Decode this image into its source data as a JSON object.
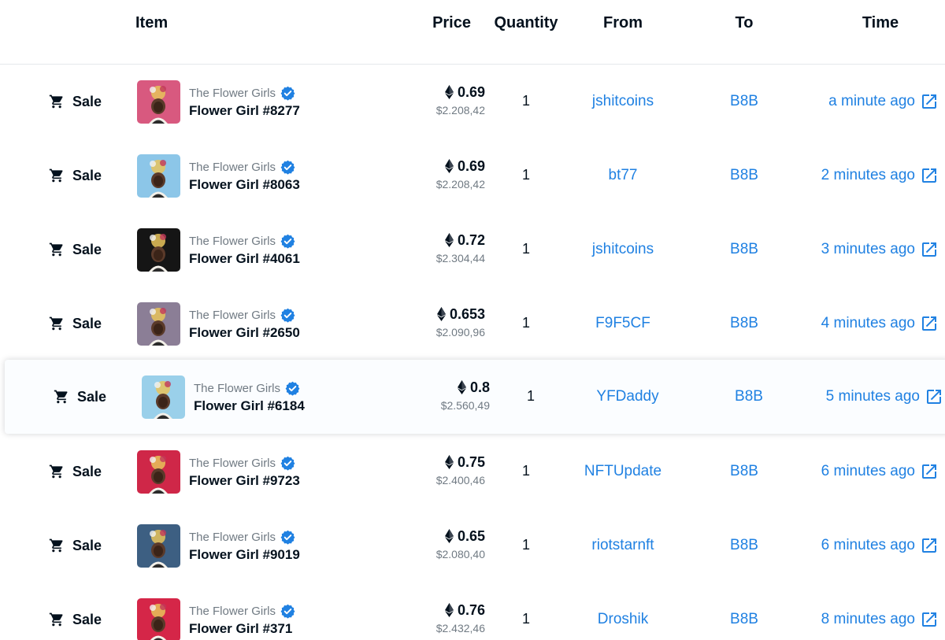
{
  "header": {
    "item": "Item",
    "price": "Price",
    "quantity": "Quantity",
    "from": "From",
    "to": "To",
    "time": "Time"
  },
  "rows": [
    {
      "event": "Sale",
      "collection": "The Flower Girls",
      "name": "Flower Girl #8277",
      "price_eth": "0.69",
      "price_usd": "$2.208,42",
      "quantity": "1",
      "from": "jshitcoins",
      "to": "B8B",
      "time": "a minute ago",
      "thumb_bg": "#d8597f"
    },
    {
      "event": "Sale",
      "collection": "The Flower Girls",
      "name": "Flower Girl #8063",
      "price_eth": "0.69",
      "price_usd": "$2.208,42",
      "quantity": "1",
      "from": "bt77",
      "to": "B8B",
      "time": "2 minutes ago",
      "thumb_bg": "#8cc6e8"
    },
    {
      "event": "Sale",
      "collection": "The Flower Girls",
      "name": "Flower Girl #4061",
      "price_eth": "0.72",
      "price_usd": "$2.304,44",
      "quantity": "1",
      "from": "jshitcoins",
      "to": "B8B",
      "time": "3 minutes ago",
      "thumb_bg": "#151515"
    },
    {
      "event": "Sale",
      "collection": "The Flower Girls",
      "name": "Flower Girl #2650",
      "price_eth": "0.653",
      "price_usd": "$2.090,96",
      "quantity": "1",
      "from": "F9F5CF",
      "to": "B8B",
      "time": "4 minutes ago",
      "thumb_bg": "#8b7e96"
    },
    {
      "event": "Sale",
      "collection": "The Flower Girls",
      "name": "Flower Girl #6184",
      "price_eth": "0.8",
      "price_usd": "$2.560,49",
      "quantity": "1",
      "from": "YFDaddy",
      "to": "B8B",
      "time": "5 minutes ago",
      "thumb_bg": "#9ad0ea"
    },
    {
      "event": "Sale",
      "collection": "The Flower Girls",
      "name": "Flower Girl #9723",
      "price_eth": "0.75",
      "price_usd": "$2.400,46",
      "quantity": "1",
      "from": "NFTUpdate",
      "to": "B8B",
      "time": "6 minutes ago",
      "thumb_bg": "#cf2748"
    },
    {
      "event": "Sale",
      "collection": "The Flower Girls",
      "name": "Flower Girl #9019",
      "price_eth": "0.65",
      "price_usd": "$2.080,40",
      "quantity": "1",
      "from": "riotstarnft",
      "to": "B8B",
      "time": "6 minutes ago",
      "thumb_bg": "#3d5f82"
    },
    {
      "event": "Sale",
      "collection": "The Flower Girls",
      "name": "Flower Girl #371",
      "price_eth": "0.76",
      "price_usd": "$2.432,46",
      "quantity": "1",
      "from": "Droshik",
      "to": "B8B",
      "time": "8 minutes ago",
      "thumb_bg": "#d52648"
    }
  ],
  "icons": {
    "event": "shopping-cart-icon",
    "verified": "verified-badge-icon",
    "currency": "ethereum-icon",
    "time_link": "external-link-icon"
  },
  "colors": {
    "link": "#2081e2",
    "text": "#04111d",
    "muted": "#707a83",
    "verified": "#2081e2"
  }
}
